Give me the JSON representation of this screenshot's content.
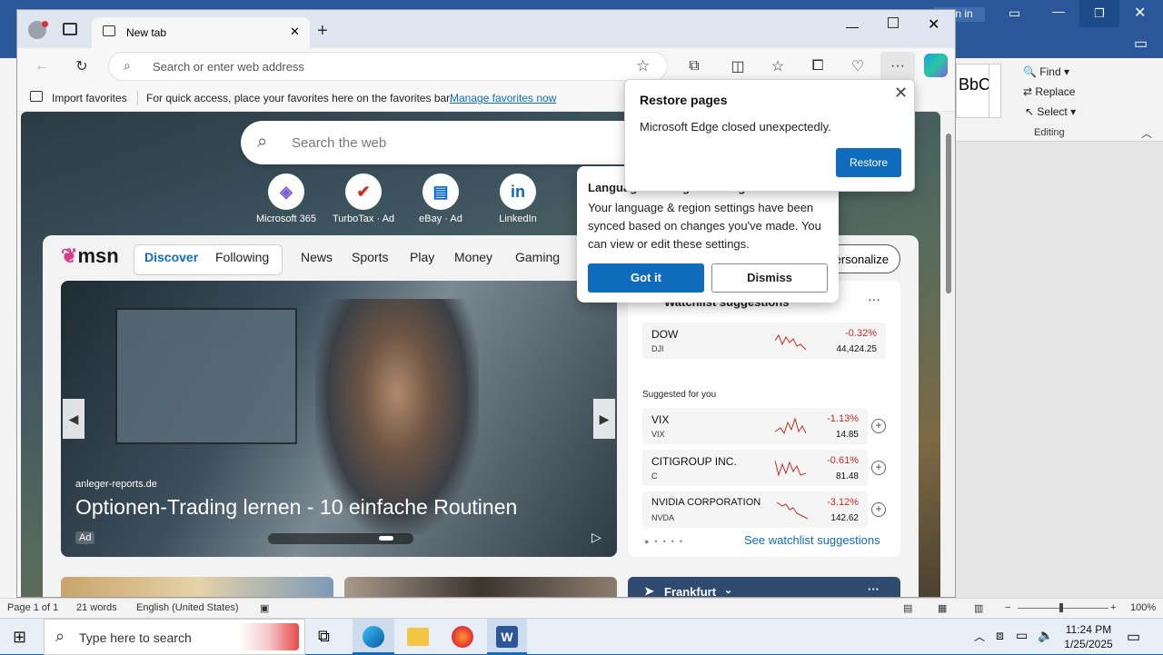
{
  "word": {
    "sign_in": "Sign in",
    "style_preview": "BbC",
    "editing_find": "Find",
    "editing_replace": "Replace",
    "editing_select": "Select",
    "editing_group": "Editing",
    "status_page": "Page 1 of 1",
    "status_words": "21 words",
    "status_language": "English (United States)",
    "zoom": "100%"
  },
  "edge": {
    "tab_title": "New tab",
    "address_placeholder": "Search or enter web address",
    "fav_import": "Import favorites",
    "fav_hint": "For quick access, place your favorites here on the favorites bar.",
    "fav_manage": "Manage favorites now"
  },
  "newtab": {
    "search_placeholder": "Search the web",
    "quick_links": [
      {
        "label": "Microsoft 365",
        "icon": "m365-icon"
      },
      {
        "label": "TurboTax · Ad",
        "icon": "turbotax-icon"
      },
      {
        "label": "eBay · Ad",
        "icon": "ebay-icon"
      },
      {
        "label": "LinkedIn",
        "icon": "linkedin-icon"
      }
    ],
    "msn_logo": "msn",
    "nav": [
      "Discover",
      "Following",
      "News",
      "Sports",
      "Play",
      "Money",
      "Gaming"
    ],
    "personalize": "Personalize",
    "hero": {
      "source": "anleger-reports.de",
      "headline": "Optionen-Trading lernen - 10 einfache Routinen",
      "ad": "Ad"
    },
    "watchlist": {
      "title": "Watchlist suggestions",
      "main": {
        "name": "DOW",
        "ticker": "DJI",
        "change": "-0.32%",
        "price": "44,424.25"
      },
      "suggested_label": "Suggested for you",
      "items": [
        {
          "name": "VIX",
          "ticker": "VIX",
          "change": "-1.13%",
          "price": "14.85"
        },
        {
          "name": "CITIGROUP INC.",
          "ticker": "C",
          "change": "-0.61%",
          "price": "81.48"
        },
        {
          "name": "NVIDIA CORPORATION",
          "ticker": "NVDA",
          "change": "-3.12%",
          "price": "142.62"
        }
      ],
      "see_more": "See watchlist suggestions"
    },
    "weather_city": "Frankfurt"
  },
  "restore_dialog": {
    "title": "Restore pages",
    "message": "Microsoft Edge closed unexpectedly.",
    "button": "Restore"
  },
  "lang_popup": {
    "title": "Language and region changed",
    "message": "Your language & region settings have been synced based on changes you've made. You can view or edit these settings.",
    "got_it": "Got it",
    "dismiss": "Dismiss"
  },
  "taskbar": {
    "search_placeholder": "Type here to search",
    "time": "11:24 PM",
    "date": "1/25/2025"
  },
  "colors": {
    "accent": "#0f6cbd",
    "negative": "#c42b1c",
    "word_blue": "#2b579a"
  }
}
